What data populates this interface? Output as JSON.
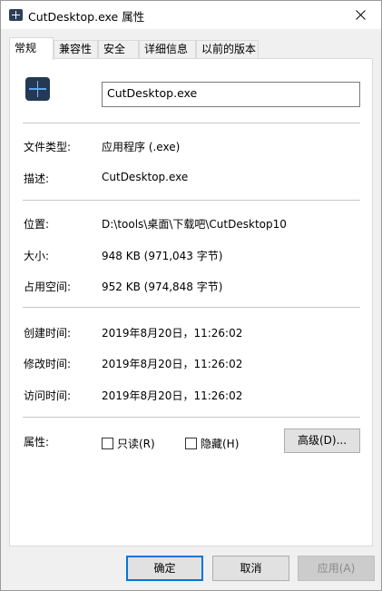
{
  "window": {
    "title": "CutDesktop.exe 属性",
    "icons": {
      "app": "app-icon",
      "close": "close-icon"
    }
  },
  "tabs": [
    {
      "label": "常规",
      "active": true
    },
    {
      "label": "兼容性",
      "active": false
    },
    {
      "label": "安全",
      "active": false
    },
    {
      "label": "详细信息",
      "active": false
    },
    {
      "label": "以前的版本",
      "active": false
    }
  ],
  "general": {
    "file_icon": "executable-file-icon",
    "file_name": "CutDesktop.exe",
    "file_type_label": "文件类型:",
    "file_type_value": "应用程序 (.exe)",
    "description_label": "描述:",
    "description_value": "CutDesktop.exe",
    "location_label": "位置:",
    "location_value": "D:\\tools\\桌面\\下载吧\\CutDesktop10",
    "size_label": "大小:",
    "size_value": "948 KB (971,043 字节)",
    "size_on_disk_label": "占用空间:",
    "size_on_disk_value": "952 KB (974,848 字节)",
    "created_label": "创建时间:",
    "created_value": "2019年8月20日，11:26:02",
    "modified_label": "修改时间:",
    "modified_value": "2019年8月20日，11:26:02",
    "accessed_label": "访问时间:",
    "accessed_value": "2019年8月20日，11:26:02",
    "attributes_label": "属性:",
    "readonly_label": "只读(R)",
    "readonly_checked": false,
    "hidden_label": "隐藏(H)",
    "hidden_checked": false,
    "advanced_button": "高级(D)..."
  },
  "buttons": {
    "ok": "确定",
    "cancel": "取消",
    "apply": "应用(A)"
  }
}
